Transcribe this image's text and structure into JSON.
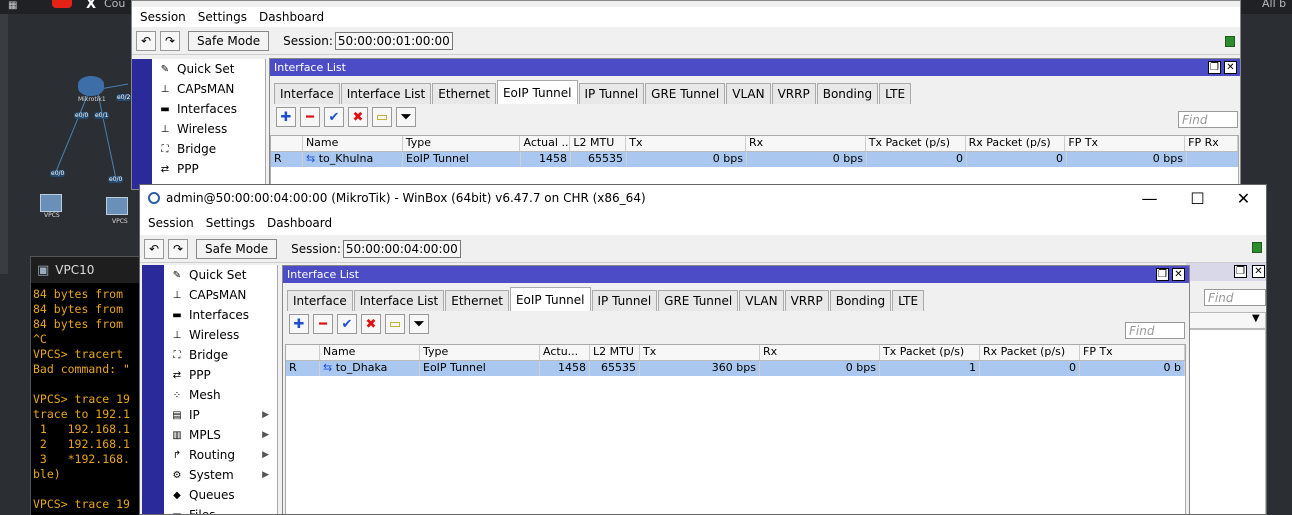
{
  "taskbar": {
    "tab1_label": "Cou",
    "tab2_label": "All b"
  },
  "topology": {
    "router_label": "Mikrotik1",
    "vpcs1_label": "VPCS",
    "vpcs2_label": "VPCS",
    "port_labels": [
      "e0/0",
      "e0/1",
      "e0/2",
      "e0/0",
      "e0/0",
      "e0/0"
    ]
  },
  "vpc_window": {
    "title": "VPC10",
    "lines": [
      "84 bytes from",
      "84 bytes from",
      "84 bytes from",
      "^C",
      "VPCS> tracert",
      "Bad command: \"",
      "",
      "VPCS> trace 19",
      "trace to 192.1",
      " 1   192.168.1",
      " 2   192.168.1",
      " 3   *192.168.",
      "ble)",
      "",
      "VPCS> trace 19"
    ]
  },
  "winbox_back": {
    "menu": [
      "Session",
      "Settings",
      "Dashboard"
    ],
    "safe_mode": "Safe Mode",
    "session_label": "Session:",
    "session_value": "50:00:00:01:00:00",
    "sidebar": [
      {
        "label": "Quick Set",
        "icon": "wand-icon"
      },
      {
        "label": "CAPsMAN",
        "icon": "antenna-icon"
      },
      {
        "label": "Interfaces",
        "icon": "interfaces-icon"
      },
      {
        "label": "Wireless",
        "icon": "wireless-icon"
      },
      {
        "label": "Bridge",
        "icon": "bridge-icon"
      },
      {
        "label": "PPP",
        "icon": "ppp-icon"
      }
    ],
    "iflist": {
      "title": "Interface List",
      "tabs": [
        "Interface",
        "Interface List",
        "Ethernet",
        "EoIP Tunnel",
        "IP Tunnel",
        "GRE Tunnel",
        "VLAN",
        "VRRP",
        "Bonding",
        "LTE"
      ],
      "active_tab": 3,
      "find_placeholder": "Find",
      "columns": [
        "",
        "Name",
        "Type",
        "Actual ...",
        "L2 MTU",
        "Tx",
        "Rx",
        "Tx Packet (p/s)",
        "Rx Packet (p/s)",
        "FP Tx",
        "FP Rx"
      ],
      "rows": [
        {
          "flag": "R",
          "name": "to_Khulna",
          "type": "EoIP Tunnel",
          "actual": "1458",
          "l2mtu": "65535",
          "tx": "0 bps",
          "rx": "0 bps",
          "txp": "0",
          "rxp": "0",
          "fptx": "0 bps"
        }
      ]
    }
  },
  "winbox_front": {
    "title": "admin@50:00:00:04:00:00 (MikroTik) - WinBox (64bit) v6.47.7 on CHR (x86_64)",
    "menu": [
      "Session",
      "Settings",
      "Dashboard"
    ],
    "safe_mode": "Safe Mode",
    "session_label": "Session:",
    "session_value": "50:00:00:04:00:00",
    "sidebar": [
      {
        "label": "Quick Set",
        "icon": "wand-icon",
        "sub": false
      },
      {
        "label": "CAPsMAN",
        "icon": "antenna-icon",
        "sub": false
      },
      {
        "label": "Interfaces",
        "icon": "interfaces-icon",
        "sub": false
      },
      {
        "label": "Wireless",
        "icon": "wireless-icon",
        "sub": false
      },
      {
        "label": "Bridge",
        "icon": "bridge-icon",
        "sub": false
      },
      {
        "label": "PPP",
        "icon": "ppp-icon",
        "sub": false
      },
      {
        "label": "Mesh",
        "icon": "mesh-icon",
        "sub": false
      },
      {
        "label": "IP",
        "icon": "ip-icon",
        "sub": true
      },
      {
        "label": "MPLS",
        "icon": "mpls-icon",
        "sub": true
      },
      {
        "label": "Routing",
        "icon": "routing-icon",
        "sub": true
      },
      {
        "label": "System",
        "icon": "system-icon",
        "sub": true
      },
      {
        "label": "Queues",
        "icon": "queues-icon",
        "sub": false
      },
      {
        "label": "Files",
        "icon": "files-icon",
        "sub": false
      }
    ],
    "iflist": {
      "title": "Interface List",
      "tabs": [
        "Interface",
        "Interface List",
        "Ethernet",
        "EoIP Tunnel",
        "IP Tunnel",
        "GRE Tunnel",
        "VLAN",
        "VRRP",
        "Bonding",
        "LTE"
      ],
      "active_tab": 3,
      "find_placeholder": "Find",
      "bg_find_placeholder": "Find",
      "columns": [
        "",
        "Name",
        "Type",
        "Actu...",
        "L2 MTU",
        "Tx",
        "Rx",
        "Tx Packet (p/s)",
        "Rx Packet (p/s)",
        "FP Tx"
      ],
      "rows": [
        {
          "flag": "R",
          "name": "to_Dhaka",
          "type": "EoIP Tunnel",
          "actual": "1458",
          "l2mtu": "65535",
          "tx": "360 bps",
          "rx": "0 bps",
          "txp": "1",
          "rxp": "0",
          "fptx": "0 b"
        }
      ]
    }
  }
}
